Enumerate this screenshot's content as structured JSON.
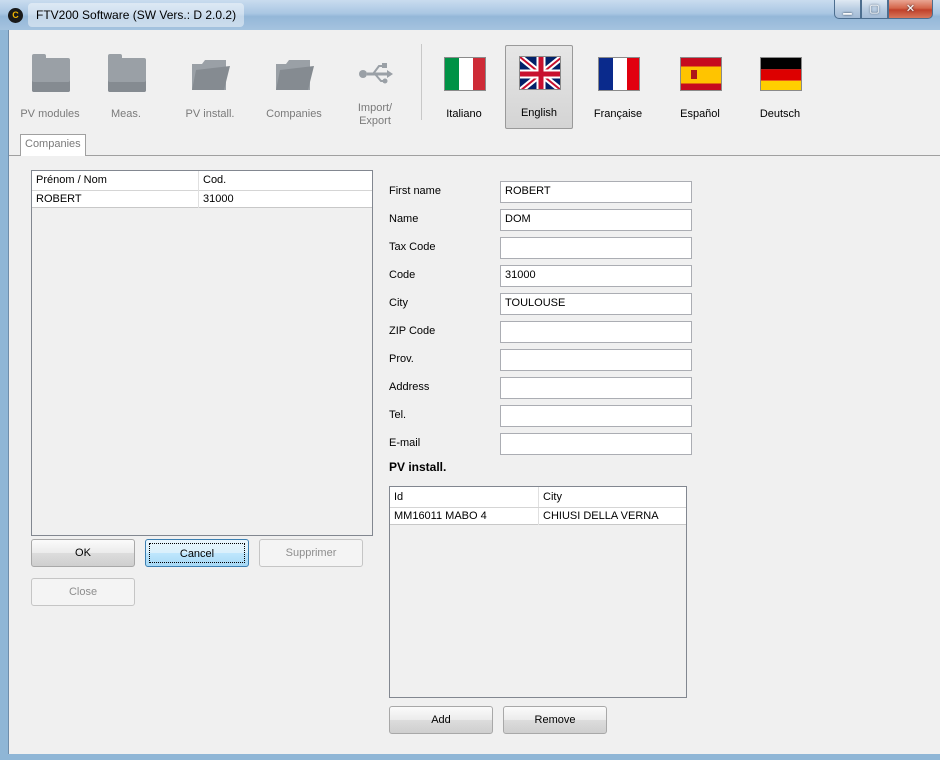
{
  "window": {
    "app_icon_glyph": "C",
    "title": "FTV200 Software (SW Vers.: D 2.0.2)",
    "min_glyph": "▁",
    "max_glyph": "▢",
    "close_glyph": "✕"
  },
  "toolbar": {
    "items": [
      {
        "label": "PV modules",
        "icon": "folder-icon"
      },
      {
        "label": "Meas.",
        "icon": "folder-icon"
      },
      {
        "label": "PV install.",
        "icon": "folder-open-icon"
      },
      {
        "label": "Companies",
        "icon": "folder-open-icon"
      },
      {
        "label_line1": "Import/",
        "label_line2": "Export",
        "icon": "usb-icon"
      }
    ],
    "languages": [
      {
        "label": "Italiano",
        "icon": "flag-italy-icon"
      },
      {
        "label": "English",
        "icon": "flag-uk-icon",
        "selected": true
      },
      {
        "label": "Française",
        "icon": "flag-france-icon"
      },
      {
        "label": "Español",
        "icon": "flag-spain-icon"
      },
      {
        "label": "Deutsch",
        "icon": "flag-germany-icon"
      }
    ]
  },
  "tabs": [
    {
      "label": "Companies"
    }
  ],
  "company_list": {
    "columns": [
      "Prénom / Nom",
      "Cod."
    ],
    "rows": [
      [
        "ROBERT",
        "31000"
      ]
    ]
  },
  "buttons": {
    "ok": "OK",
    "cancel": "Cancel",
    "delete": "Supprimer",
    "close": "Close"
  },
  "form": {
    "first_name": {
      "label": "First name",
      "value": "ROBERT"
    },
    "name": {
      "label": "Name",
      "value": "DOM"
    },
    "tax_code": {
      "label": "Tax Code",
      "value": ""
    },
    "code": {
      "label": "Code",
      "value": "31000"
    },
    "city": {
      "label": "City",
      "value": "TOULOUSE"
    },
    "zip_code": {
      "label": "ZIP Code",
      "value": ""
    },
    "prov": {
      "label": "Prov.",
      "value": ""
    },
    "address": {
      "label": "Address",
      "value": ""
    },
    "tel": {
      "label": "Tel.",
      "value": ""
    },
    "email": {
      "label": "E-mail",
      "value": ""
    }
  },
  "pv_install": {
    "title": "PV install.",
    "columns": [
      "Id",
      "City"
    ],
    "rows": [
      [
        "MM16011 MABO 4",
        "CHIUSI DELLA VERNA"
      ]
    ],
    "add_label": "Add",
    "remove_label": "Remove"
  },
  "colors": {
    "titlebar": "#a9c6e2",
    "client_bg": "#f0f0f0",
    "close_button": "#c0412a"
  }
}
